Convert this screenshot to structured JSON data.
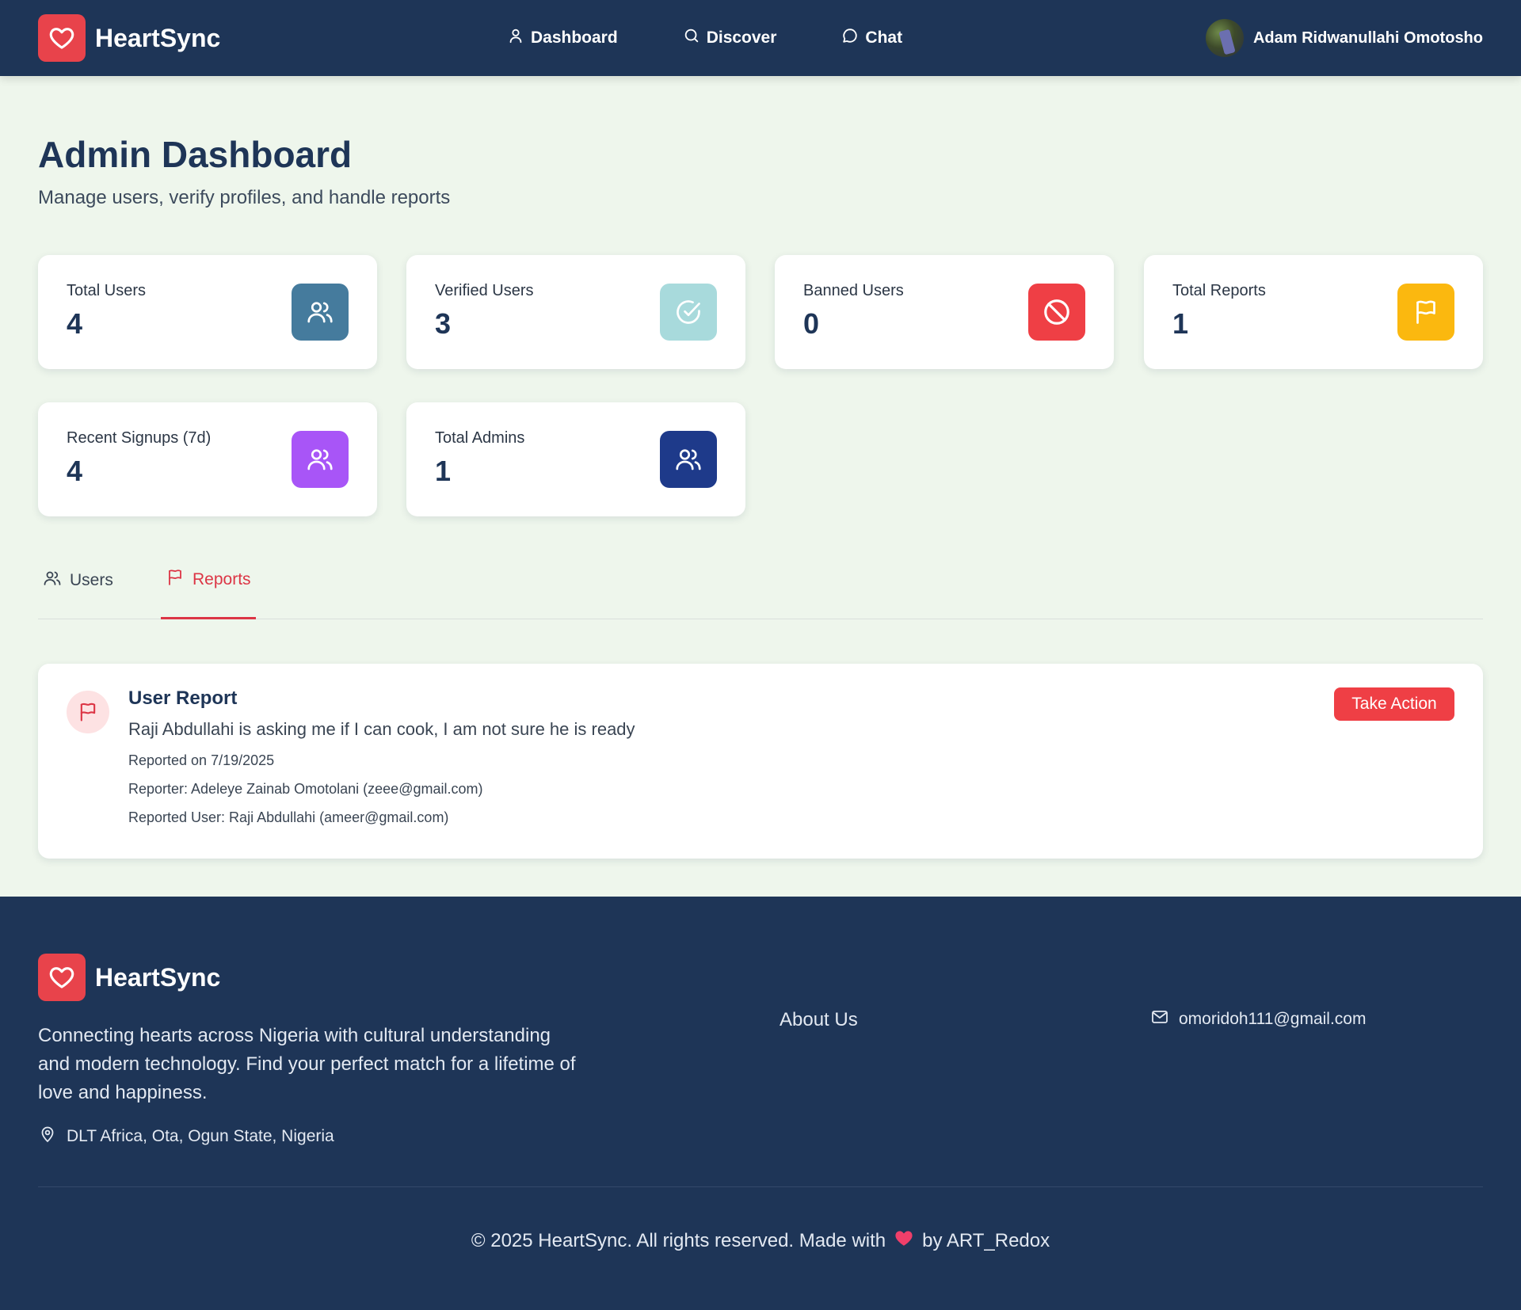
{
  "header": {
    "brand": "HeartSync",
    "nav": [
      {
        "label": "Dashboard",
        "icon": "user-icon"
      },
      {
        "label": "Discover",
        "icon": "search-icon"
      },
      {
        "label": "Chat",
        "icon": "chat-icon"
      }
    ],
    "user_name": "Adam Ridwanullahi Omotosho"
  },
  "page": {
    "title": "Admin Dashboard",
    "subtitle": "Manage users, verify profiles, and handle reports"
  },
  "stats": [
    {
      "label": "Total Users",
      "value": "4",
      "icon": "users-icon",
      "color": "#457b9d"
    },
    {
      "label": "Verified Users",
      "value": "3",
      "icon": "check-circle-icon",
      "color": "#a8dadc"
    },
    {
      "label": "Banned Users",
      "value": "0",
      "icon": "ban-icon",
      "color": "#ef3f45"
    },
    {
      "label": "Total Reports",
      "value": "1",
      "icon": "flag-icon",
      "color": "#fbb80f"
    },
    {
      "label": "Recent Signups (7d)",
      "value": "4",
      "icon": "users-icon",
      "color": "#a855f7"
    },
    {
      "label": "Total Admins",
      "value": "1",
      "icon": "users-icon",
      "color": "#1e3a8a"
    }
  ],
  "tabs": [
    {
      "label": "Users",
      "icon": "users-icon",
      "active": false
    },
    {
      "label": "Reports",
      "icon": "flag-icon",
      "active": true
    }
  ],
  "report": {
    "title": "User Report",
    "message": "Raji Abdullahi is asking me if I can cook, I am not sure he is ready",
    "reported_on": "Reported on 7/19/2025",
    "reporter": "Reporter: Adeleye Zainab Omotolani (zeee@gmail.com)",
    "reported_user": "Reported User: Raji Abdullahi (ameer@gmail.com)",
    "action_label": "Take Action"
  },
  "footer": {
    "brand": "HeartSync",
    "description": "Connecting hearts across Nigeria with cultural understanding and modern technology. Find your perfect match for a lifetime of love and happiness.",
    "location": "DLT Africa, Ota, Ogun State, Nigeria",
    "about_link": "About Us",
    "email": "omoridoh111@gmail.com",
    "copyright_pre": "© 2025 HeartSync. All rights reserved. Made with",
    "copyright_post": "by ART_Redox"
  },
  "colors": {
    "navy": "#1e3557",
    "accent_red": "#ef3f45",
    "background": "#eef6ec"
  }
}
